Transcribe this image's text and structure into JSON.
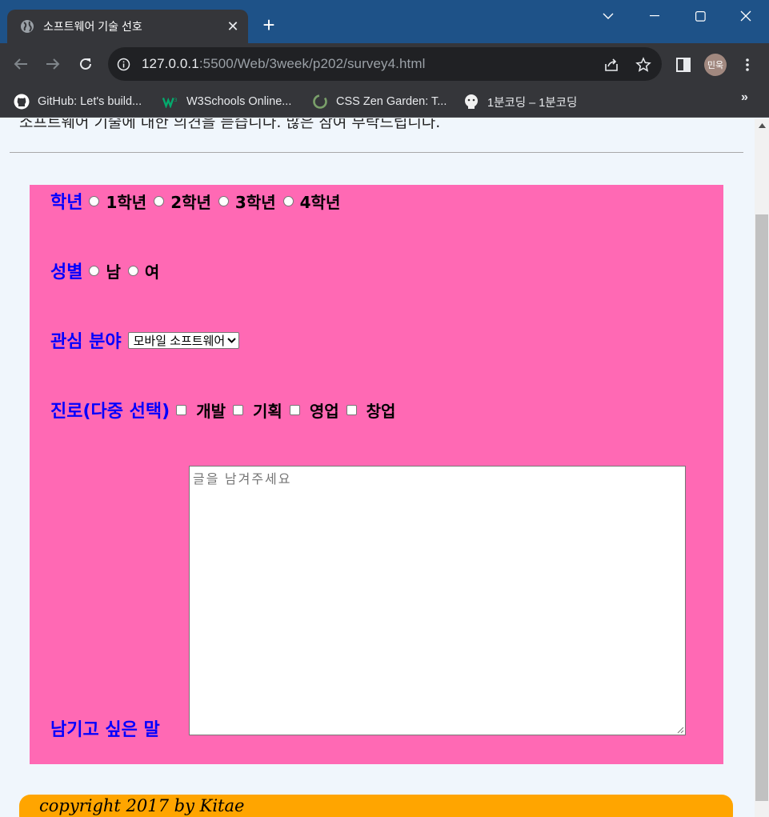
{
  "browser": {
    "tab_title": "소프트웨어 기술 선호",
    "url_host": "127.0.0.1",
    "url_path": ":5500/Web/3week/p202/survey4.html",
    "profile_label": "민욱",
    "bookmarks": [
      {
        "label": "GitHub: Let's build...",
        "icon": "github-icon"
      },
      {
        "label": "W3Schools Online...",
        "icon": "w3schools-icon"
      },
      {
        "label": "CSS Zen Garden: T...",
        "icon": "css-zen-garden-icon"
      },
      {
        "label": "1분코딩 – 1분코딩",
        "icon": "1bun-coding-icon"
      }
    ],
    "bookmarks_more": "»"
  },
  "page": {
    "intro_text": "소프트웨어 기술에 대한 의견을 듣습니다. 많은 참여 부탁드립니다.",
    "form": {
      "grade": {
        "label": "학년",
        "options": [
          "1학년",
          "2학년",
          "3학년",
          "4학년"
        ]
      },
      "gender": {
        "label": "성별",
        "options": [
          "남",
          "여"
        ]
      },
      "interest": {
        "label": "관심 분야",
        "selected": "모바일 소프트웨어"
      },
      "career": {
        "label": "진로(다중 선택)",
        "options": [
          "개발",
          "기획",
          "영업",
          "창업"
        ]
      },
      "comment": {
        "label": "남기고 싶은 말",
        "placeholder": "글을 남겨주세요"
      }
    },
    "footer_text": "copyright 2017 by Kitae"
  },
  "colors": {
    "tabstrip": "#1e5288",
    "form_background": "#ff69b4",
    "label_text": "#0000ff",
    "footer_background": "#ffa500"
  }
}
